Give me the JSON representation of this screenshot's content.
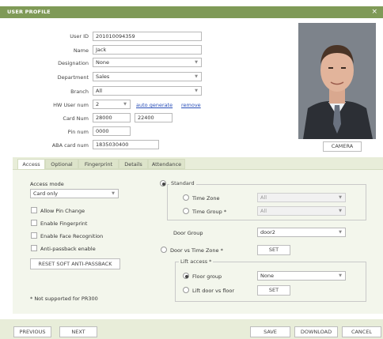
{
  "window": {
    "title": "USER PROFILE",
    "close": "×"
  },
  "form": {
    "user_id": {
      "label": "User ID",
      "value": "201010094359"
    },
    "name": {
      "label": "Name",
      "value": "Jack"
    },
    "designation": {
      "label": "Designation",
      "value": "None"
    },
    "department": {
      "label": "Department",
      "value": "Sales"
    },
    "branch": {
      "label": "Branch",
      "value": "All"
    },
    "hw_user_num": {
      "label": "HW User num",
      "value": "2",
      "auto_generate": "auto generate",
      "remove": "remove"
    },
    "card_num": {
      "label": "Card Num",
      "value1": "28000",
      "value2": "22400"
    },
    "pin_num": {
      "label": "Pin num",
      "value": "0000"
    },
    "aba_card_num": {
      "label": "ABA card num",
      "value": "1835030400"
    }
  },
  "camera_button": "CAMERA",
  "tabs": [
    {
      "label": "Access"
    },
    {
      "label": "Optional"
    },
    {
      "label": "Fingerprint"
    },
    {
      "label": "Details"
    },
    {
      "label": "Attendance"
    }
  ],
  "access": {
    "mode_label": "Access mode",
    "mode_value": "Card only",
    "allow_pin_change": "Allow Pin Change",
    "enable_fingerprint": "Enable Fingerprint",
    "enable_face": "Enable Face Recognition",
    "anti_passback": "Anti-passback enable",
    "reset_button": "RESET SOFT ANTI-PASSBACK",
    "note": "* Not supported for PR300",
    "standard": "Standard",
    "time_zone": "Time Zone",
    "time_zone_value": "All",
    "time_group": "Time Group *",
    "time_group_value": "All",
    "door_group_label": "Door Group",
    "door_group_value": "door2",
    "door_vs_tz": "Door vs Time Zone *",
    "set1": "SET",
    "lift_access": "Lift access *",
    "floor_group": "Floor group",
    "floor_group_value": "None",
    "lift_door": "Lift door vs floor",
    "set2": "SET"
  },
  "footer": {
    "previous": "PREVIOUS",
    "next": "NEXT",
    "save": "SAVE",
    "download": "DOWNLOAD",
    "cancel": "CANCEL"
  },
  "colors": {
    "titlebar": "#7f9a57",
    "panel": "#f3f6ec",
    "link": "#2a4fb8"
  }
}
